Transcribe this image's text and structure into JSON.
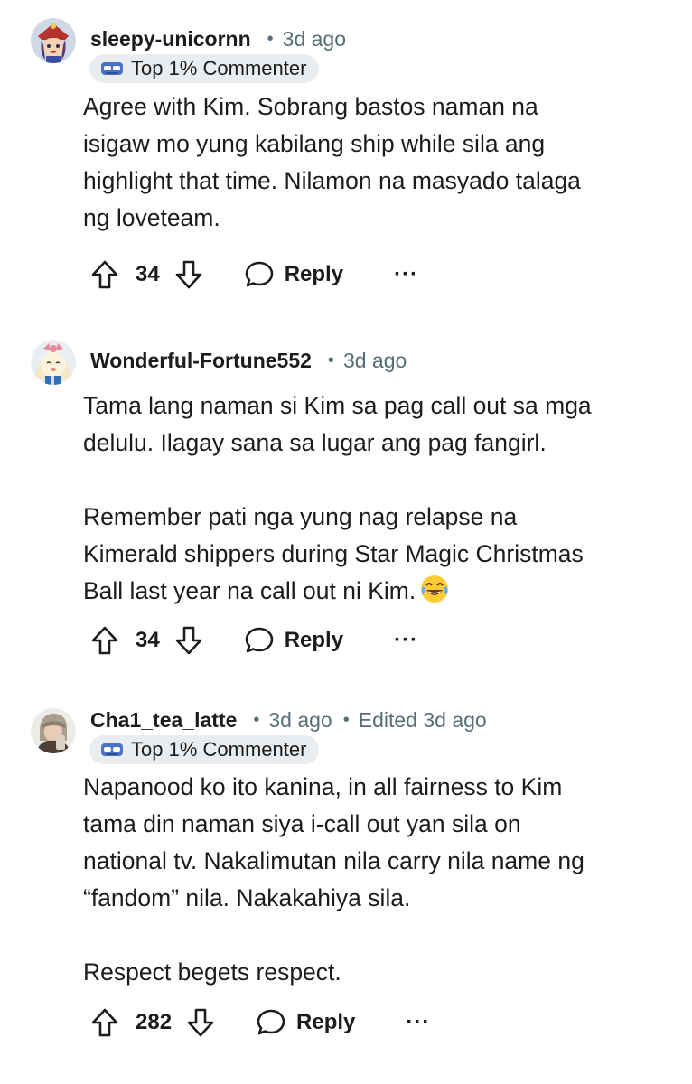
{
  "comments": [
    {
      "username": "sleepy-unicornn",
      "separator": "•",
      "time": "3d ago",
      "flair": "Top 1% Commenter",
      "body": [
        "Agree with Kim. Sobrang bastos naman na",
        "isigaw mo yung kabilang ship while sila ang",
        "highlight that time. Nilamon na masyado talaga",
        "ng loveteam."
      ],
      "score": "34",
      "reply_label": "Reply",
      "more_label": "···"
    },
    {
      "username": "Wonderful-Fortune552",
      "separator": "•",
      "time": "3d ago",
      "body_p1": [
        "Tama lang naman si Kim sa pag call out sa mga",
        "delulu. Ilagay sana sa lugar ang pag fangirl."
      ],
      "body_p2": [
        "Remember pati nga yung nag relapse na",
        "Kimerald shippers during Star Magic Christmas",
        "Ball last year na call out ni Kim."
      ],
      "emoji": "face-with-tears-of-joy-icon",
      "score": "34",
      "reply_label": "Reply",
      "more_label": "···"
    },
    {
      "username": "Cha1_tea_latte",
      "separator": "•",
      "time": "3d ago",
      "separator2": "•",
      "edited": "Edited 3d ago",
      "flair": "Top 1% Commenter",
      "body_p1": [
        "Napanood ko ito kanina, in all fairness to Kim",
        "tama din naman siya i-call out yan sila on",
        "national tv. Nakalimutan nila carry nila name ng",
        "“fandom” nila. Nakakahiya sila."
      ],
      "body_p2": [
        "Respect begets respect."
      ],
      "score": "282",
      "reply_label": "Reply",
      "more_label": "···"
    }
  ],
  "colors": {
    "text": "#1c1c1c",
    "meta": "#576f76",
    "flair_bg": "#eaedef",
    "flair_icon": "#4a74c7"
  }
}
